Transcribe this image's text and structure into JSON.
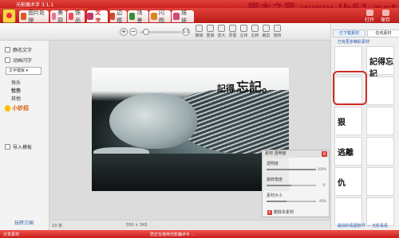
{
  "window": {
    "title": "光影魔术手 3.1.1",
    "watermark": "脚本之家 www.Jb51.net"
  },
  "tabs": [
    {
      "label": "图片处理",
      "color": "#d85a25"
    },
    {
      "label": "美容",
      "color": "#e8739d"
    },
    {
      "label": "饰品",
      "color": "#ea4a5a"
    },
    {
      "label": "文字",
      "color": "#c7376b",
      "active": true
    },
    {
      "label": "边框",
      "color": "#d14a2e"
    },
    {
      "label": "场景",
      "color": "#3a8d39"
    },
    {
      "label": "闪图",
      "color": "#d98623"
    },
    {
      "label": "娃娃",
      "color": "#cc4a7c"
    }
  ],
  "ribbon_right": [
    "打开",
    "保存"
  ],
  "toolbar": {
    "zoom_in": "+",
    "zoom_out": "−",
    "zoom_fit": "1:1",
    "tools": [
      "撤销",
      "重做",
      "放大",
      "原图",
      "左转",
      "右转",
      "裁剪",
      "旋转"
    ]
  },
  "left_panel": {
    "items": [
      "静态文字",
      "动画闪字"
    ],
    "category_select": "文字模板",
    "sub_items": [
      "快乐",
      "忧伤",
      "其他"
    ],
    "sub_active": "忧伤",
    "import_button": "导入模板",
    "tip_title": "小妙招",
    "footer_link": "玩转三国"
  },
  "canvas": {
    "overlay_text_a": "記得",
    "overlay_text_b": "忘記。"
  },
  "material_panel": {
    "title": "素材 透明度",
    "rows": [
      {
        "label": "透明度",
        "value": "100%",
        "level": 1.0
      },
      {
        "label": "旋转角度",
        "value": "0°",
        "level": 0.5
      },
      {
        "label": "素材大小",
        "value": "40%",
        "level": 0.4
      }
    ],
    "delete_button": "删除本素材"
  },
  "right_panel": {
    "tabs": [
      "已下载素材",
      "在线素材"
    ],
    "link": "已有更多精彩素材",
    "thumb_glyphs": [
      "",
      "記得忘記",
      "",
      "",
      "狠",
      "",
      "逃離",
      "",
      "仇",
      "",
      "",
      ""
    ],
    "more_link": "最快的看图软件 — 光影看看"
  },
  "statusbar": {
    "zoom": "23  张",
    "dimension": "550 × 343",
    "hint": "您正在使用光影魔术手 ...",
    "left_label": "分享素材"
  }
}
